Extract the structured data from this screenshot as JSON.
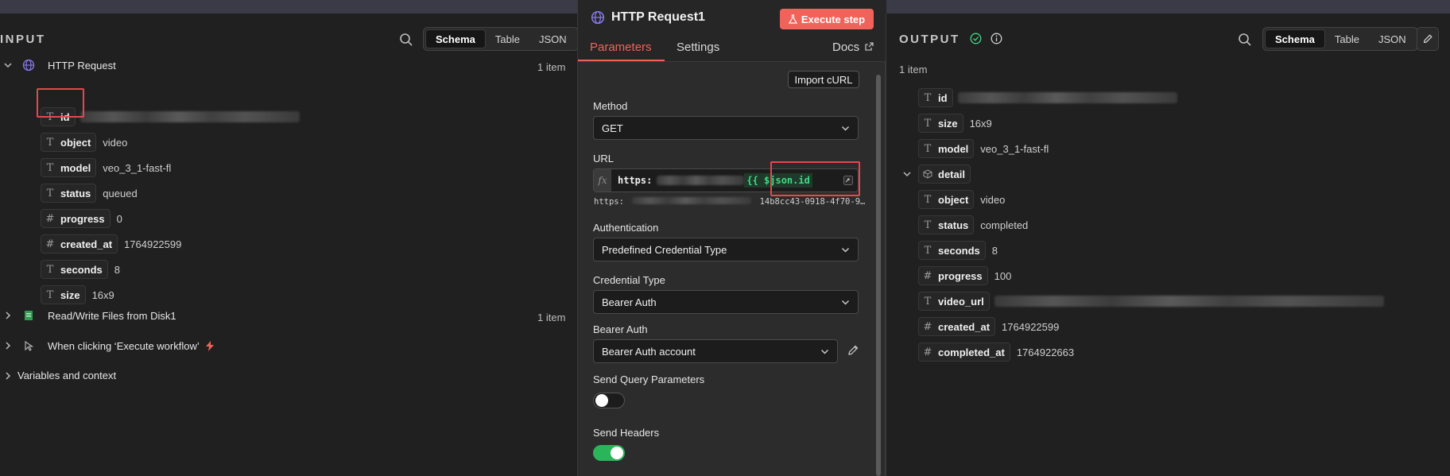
{
  "input": {
    "title": "INPUT",
    "view_options": [
      "Schema",
      "Table",
      "JSON"
    ],
    "active_view": "Schema",
    "nodes": [
      {
        "name": "HTTP Request",
        "count": "1 item",
        "expanded": true,
        "fields": [
          {
            "type": "T",
            "key": "id",
            "value": ""
          },
          {
            "type": "T",
            "key": "object",
            "value": "video"
          },
          {
            "type": "T",
            "key": "model",
            "value": "veo_3_1-fast-fl"
          },
          {
            "type": "T",
            "key": "status",
            "value": "queued"
          },
          {
            "type": "#",
            "key": "progress",
            "value": "0"
          },
          {
            "type": "#",
            "key": "created_at",
            "value": "1764922599"
          },
          {
            "type": "T",
            "key": "seconds",
            "value": "8"
          },
          {
            "type": "T",
            "key": "size",
            "value": "16x9"
          }
        ]
      },
      {
        "name": "Read/Write Files from Disk1",
        "count": "1 item"
      },
      {
        "name": "When clicking ‘Execute workflow’"
      },
      {
        "name": "Variables and context"
      }
    ]
  },
  "node_panel": {
    "title": "HTTP Request1",
    "execute_label": "Execute step",
    "tabs": [
      "Parameters",
      "Settings"
    ],
    "docs_label": "Docs",
    "import_curl_label": "Import cURL",
    "method": {
      "label": "Method",
      "value": "GET"
    },
    "url": {
      "label": "URL",
      "fx": "fx",
      "prefix": "https:",
      "expression": "{{ $json.id",
      "preview_start": "https:",
      "preview_end": "14b8cc43-0918-4f70-9…"
    },
    "authentication": {
      "label": "Authentication",
      "value": "Predefined Credential Type"
    },
    "credential_type": {
      "label": "Credential Type",
      "value": "Bearer Auth"
    },
    "bearer_auth": {
      "label": "Bearer Auth",
      "value": "Bearer Auth account"
    },
    "send_query": {
      "label": "Send Query Parameters",
      "on": false
    },
    "send_headers": {
      "label": "Send Headers",
      "on": true
    }
  },
  "output": {
    "title": "OUTPUT",
    "view_options": [
      "Schema",
      "Table",
      "JSON"
    ],
    "active_view": "Schema",
    "item_count": "1 item",
    "fields": [
      {
        "type": "T",
        "key": "id",
        "value": ""
      },
      {
        "type": "T",
        "key": "size",
        "value": "16x9"
      },
      {
        "type": "T",
        "key": "model",
        "value": "veo_3_1-fast-fl"
      }
    ],
    "detail": {
      "key": "detail",
      "fields": [
        {
          "type": "T",
          "key": "object",
          "value": "video"
        },
        {
          "type": "T",
          "key": "status",
          "value": "completed"
        },
        {
          "type": "T",
          "key": "seconds",
          "value": "8"
        },
        {
          "type": "#",
          "key": "progress",
          "value": "100"
        },
        {
          "type": "T",
          "key": "video_url",
          "value": ""
        },
        {
          "type": "#",
          "key": "created_at",
          "value": "1764922599"
        },
        {
          "type": "#",
          "key": "completed_at",
          "value": "1764922663"
        }
      ]
    }
  },
  "colors": {
    "accent": "#f0635b",
    "success": "#3ddc84",
    "highlight": "#e5484d",
    "background": "#202020"
  }
}
